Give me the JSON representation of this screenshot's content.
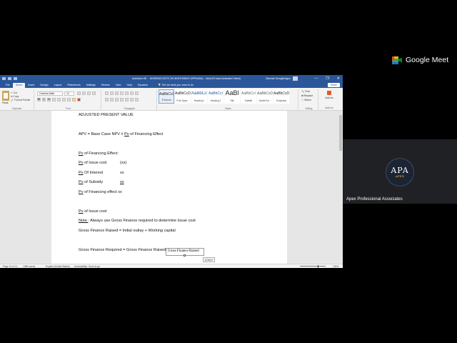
{
  "meet": {
    "brand": "Google Meet",
    "participant_name": "Apex Professional Associates",
    "avatar_text": "APA",
    "avatar_subtext": "APEX"
  },
  "word": {
    "titlebar": {
      "autosave": "AutoSave  Off",
      "doc_title": "WORKING NOTE ON INVESTMENT APPRAISAL",
      "app_name": "Word (Product Activation Failed)",
      "user": "Olumide Omogbenigun",
      "minimize": "—",
      "restore": "❐",
      "close": "✕"
    },
    "tabs": [
      "File",
      "Home",
      "Insert",
      "Design",
      "Layout",
      "References",
      "Mailings",
      "Review",
      "View",
      "Help",
      "Equation"
    ],
    "active_tab": "Home",
    "tell_me": "Tell me what you want to do",
    "share": "Share",
    "ribbon": {
      "clipboard": {
        "paste": "Paste",
        "cut": "Cut",
        "copy": "Copy",
        "format_painter": "Format Painter",
        "label": "Clipboard"
      },
      "font": {
        "name": "Cambria Math",
        "size": "12",
        "bold": "B",
        "italic": "I",
        "underline": "U",
        "label": "Font"
      },
      "paragraph_label": "Paragraph",
      "styles": [
        {
          "sample": "AaBbCcDı",
          "name": "¶ Normal"
        },
        {
          "sample": "AaBbCcDı",
          "name": "¶ No Spac..."
        },
        {
          "sample": "AaBbCcI",
          "name": "Heading 1"
        },
        {
          "sample": "AaBbCcI",
          "name": "Heading 2"
        },
        {
          "sample": "AaBl",
          "name": "Title"
        },
        {
          "sample": "AaBbCcI",
          "name": "Subtitle"
        },
        {
          "sample": "AaBbCcDı",
          "name": "Subtle Em..."
        },
        {
          "sample": "AaBbCcDı",
          "name": "Emphasis"
        }
      ],
      "styles_label": "Styles",
      "editing": {
        "find": "Find",
        "replace": "Replace",
        "select": "Select",
        "label": "Editing"
      },
      "addins": {
        "name": "Add-ins",
        "label": "Add-ins"
      }
    },
    "document": {
      "lines": [
        {
          "parts": [
            {
              "t": "ADJUSTED PRESENT VALUE",
              "u": false
            }
          ]
        },
        {
          "parts": [
            {
              "t": "APV = Base Case NPV ± ",
              "u": false
            },
            {
              "t": "Pv",
              "u": true
            },
            {
              "t": " of Financing Effect",
              "u": false
            }
          ]
        },
        {
          "parts": [
            {
              "t": "Pv",
              "u": true
            },
            {
              "t": " of Financing Effect:",
              "u": false
            }
          ]
        },
        {
          "parts": [
            {
              "t": "Pv",
              "u": true
            },
            {
              "t": " of Issue cost",
              "u": false
            }
          ]
        },
        {
          "parts": [
            {
              "t": "Pv",
              "u": true
            },
            {
              "t": " Of Interest",
              "u": false
            }
          ]
        },
        {
          "parts": [
            {
              "t": "Pv",
              "u": true
            },
            {
              "t": " of Subsidy",
              "u": false
            }
          ]
        },
        {
          "parts": [
            {
              "t": "Pv",
              "u": true
            },
            {
              "t": " of Financing effect xx",
              "u": false
            }
          ]
        },
        {
          "parts": [
            {
              "t": "Pv",
              "u": true
            },
            {
              "t": " of Issue cost",
              "u": false
            }
          ]
        },
        {
          "parts": [
            {
              "t": "Note ",
              "u": true
            },
            {
              "t": ": Always use Gross Finance required to determine Issue cost",
              "u": false
            }
          ]
        },
        {
          "parts": [
            {
              "t": "Gross Finance Raised = Initial outlay + Working capital",
              "u": false
            }
          ]
        },
        {
          "parts": [
            {
              "t": "Gross Finance Required = Gross Finance Raised",
              "u": false
            }
          ]
        }
      ],
      "amounts": [
        {
          "t": "(xx)",
          "u": false
        },
        {
          "t": "xx",
          "u": false
        },
        {
          "t": "xx",
          "u": true
        }
      ],
      "equation_popup": "Gross Finance Raised",
      "equation_chip": "(Ctrl) ▾"
    },
    "statusbar": {
      "page": "Page 14 of 14",
      "words": "1086 words",
      "language": "English (United States)",
      "accessibility": "Accessibility: Good to go",
      "zoom": "100%"
    }
  }
}
